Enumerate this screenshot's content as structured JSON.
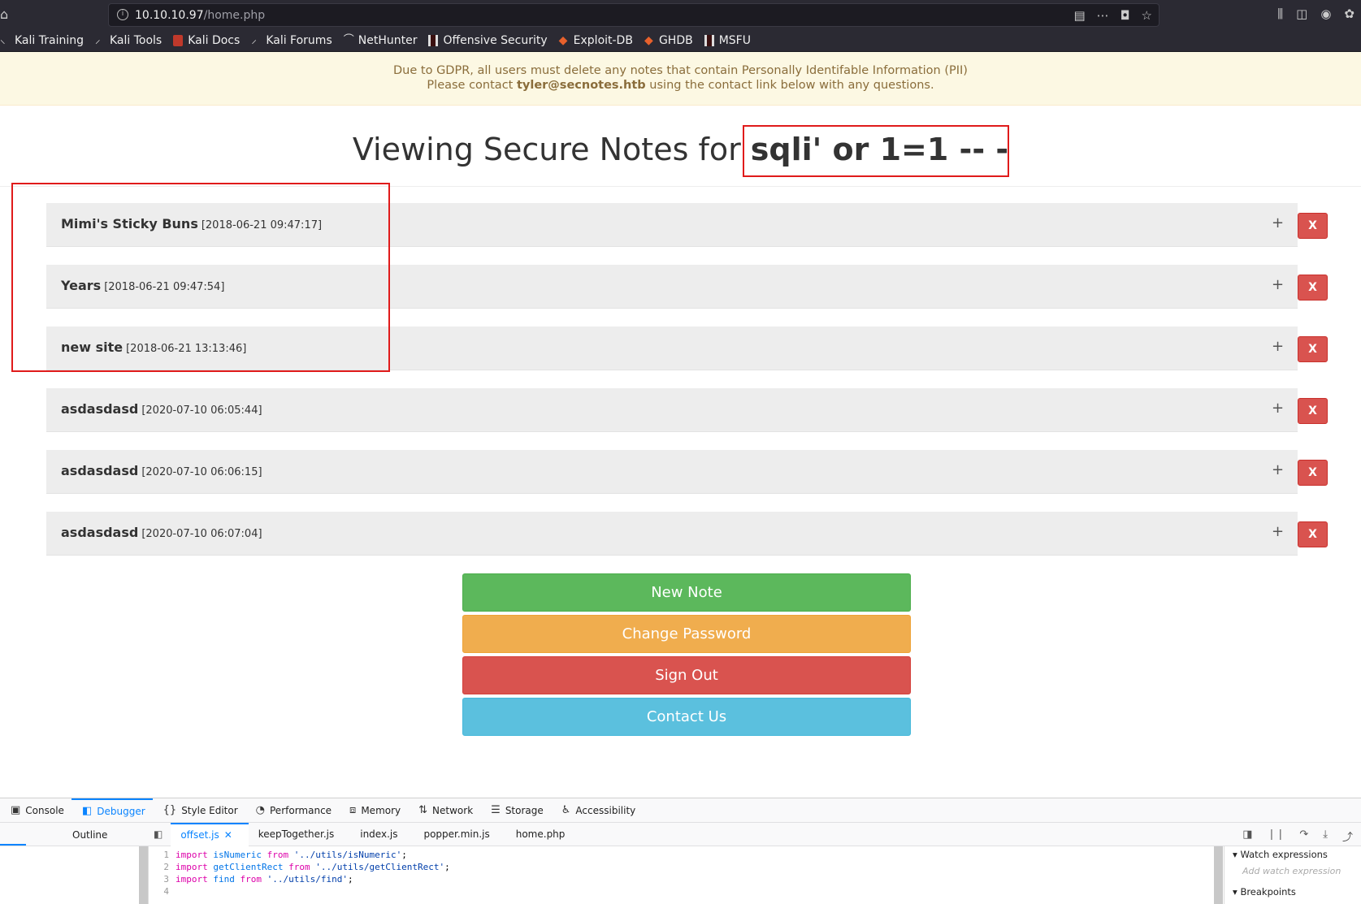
{
  "browser": {
    "url_host": "10.10.10.97",
    "url_path": "/home.php"
  },
  "bookmarks": [
    {
      "label": "Kali Training",
      "icon": "kali-dragon-icon"
    },
    {
      "label": "Kali Tools",
      "icon": "kali-dragon-icon"
    },
    {
      "label": "Kali Docs",
      "icon": "kali-docs-icon"
    },
    {
      "label": "Kali Forums",
      "icon": "kali-dragon-icon"
    },
    {
      "label": "NetHunter",
      "icon": "nethunter-icon"
    },
    {
      "label": "Offensive Security",
      "icon": "offsec-icon"
    },
    {
      "label": "Exploit-DB",
      "icon": "exploit-db-icon"
    },
    {
      "label": "GHDB",
      "icon": "ghdb-icon"
    },
    {
      "label": "MSFU",
      "icon": "offsec-icon"
    }
  ],
  "banner": {
    "line1": "Due to GDPR, all users must delete any notes that contain Personally Identifable Information (PII)",
    "line2_prefix": "Please contact ",
    "email": "tyler@secnotes.htb",
    "line2_suffix": " using the contact link below with any questions."
  },
  "heading": {
    "prefix": "Viewing Secure Notes for ",
    "username": "sqli' or 1=1 -- -"
  },
  "notes": [
    {
      "title": "Mimi's Sticky Buns",
      "date": "[2018-06-21 09:47:17]",
      "expand": "+",
      "delete": "X"
    },
    {
      "title": "Years",
      "date": "[2018-06-21 09:47:54]",
      "expand": "+",
      "delete": "X"
    },
    {
      "title": "new site",
      "date": "[2018-06-21 13:13:46]",
      "expand": "+",
      "delete": "X"
    },
    {
      "title": "asdasdasd",
      "date": "[2020-07-10 06:05:44]",
      "expand": "+",
      "delete": "X"
    },
    {
      "title": "asdasdasd",
      "date": "[2020-07-10 06:06:15]",
      "expand": "+",
      "delete": "X"
    },
    {
      "title": "asdasdasd",
      "date": "[2020-07-10 06:07:04]",
      "expand": "+",
      "delete": "X"
    }
  ],
  "actions": {
    "new_note": "New Note",
    "change_password": "Change Password",
    "sign_out": "Sign Out",
    "contact_us": "Contact Us"
  },
  "devtools": {
    "tabs": [
      "Console",
      "Debugger",
      "Style Editor",
      "Performance",
      "Memory",
      "Network",
      "Storage",
      "Accessibility"
    ],
    "active_tab": "Debugger",
    "outline_label": "Outline",
    "source_tabs": [
      "offset.js",
      "keepTogether.js",
      "index.js",
      "popper.min.js",
      "home.php"
    ],
    "close_glyph": "✕",
    "code_lines": [
      {
        "num": "1",
        "kw1": "import",
        "id": "isNumeric",
        "kw2": "from",
        "str": "'../utils/isNumeric'",
        "end": ";"
      },
      {
        "num": "2",
        "kw1": "import",
        "id": "getClientRect",
        "kw2": "from",
        "str": "'../utils/getClientRect'",
        "end": ";"
      },
      {
        "num": "3",
        "kw1": "import",
        "id": "find",
        "kw2": "from",
        "str": "'../utils/find'",
        "end": ";"
      },
      {
        "num": "4",
        "kw1": "",
        "id": "",
        "kw2": "",
        "str": "",
        "end": ""
      }
    ],
    "watch_expressions": "Watch expressions",
    "add_watch": "Add watch expression",
    "breakpoints": "Breakpoints"
  }
}
